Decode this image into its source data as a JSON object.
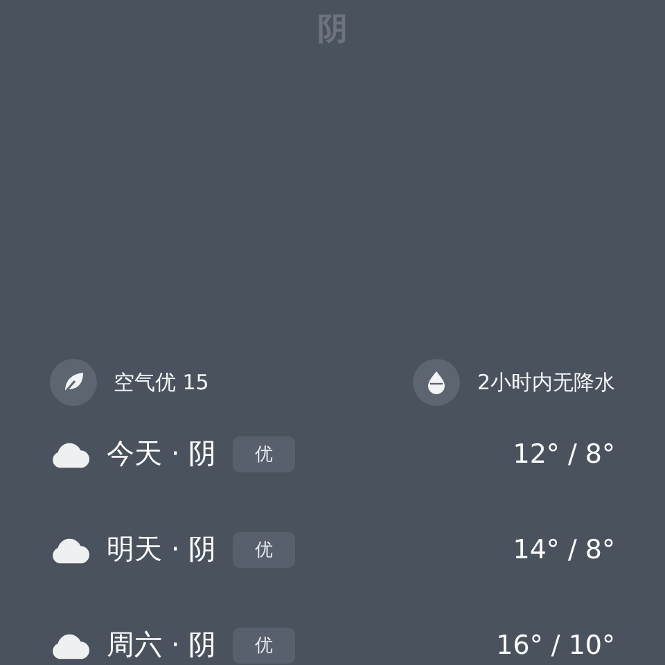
{
  "condition": "阴",
  "info": [
    {
      "kind": "air",
      "text": "空气优 15"
    },
    {
      "kind": "rain",
      "text": "2小时内无降水"
    }
  ],
  "forecast": [
    {
      "day": "今天 · 阴",
      "quality": "优",
      "temp": "12° / 8°"
    },
    {
      "day": "明天 · 阴",
      "quality": "优",
      "temp": "14° / 8°"
    },
    {
      "day": "周六 · 阴",
      "quality": "优",
      "temp": "16° / 10°"
    }
  ]
}
